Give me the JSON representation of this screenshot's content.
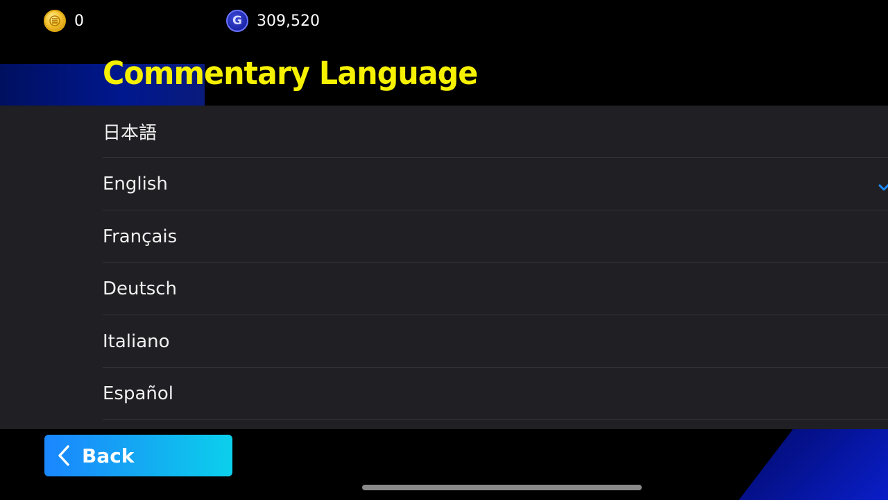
{
  "currency": {
    "coins": {
      "icon": "coin-icon",
      "value": "0",
      "color": "#f5c430"
    },
    "gp": {
      "icon": "gp-icon",
      "glyph": "G",
      "value": "309,520",
      "color": "#1c25a8"
    }
  },
  "page": {
    "title": "Commentary Language",
    "title_color": "#f6f100"
  },
  "languages": [
    {
      "label": "日本語",
      "selected": false
    },
    {
      "label": "English",
      "selected": true
    },
    {
      "label": "Français",
      "selected": false
    },
    {
      "label": "Deutsch",
      "selected": false
    },
    {
      "label": "Italiano",
      "selected": false
    },
    {
      "label": "Español",
      "selected": false
    }
  ],
  "selection_icon": "checkmark-icon",
  "footer": {
    "back_label": "Back",
    "back_icon": "chevron-left-icon"
  },
  "colors": {
    "background": "#000000",
    "list_background": "#1f1f24",
    "accent_blue": "#1a86ff",
    "check": "#1a8cff"
  }
}
